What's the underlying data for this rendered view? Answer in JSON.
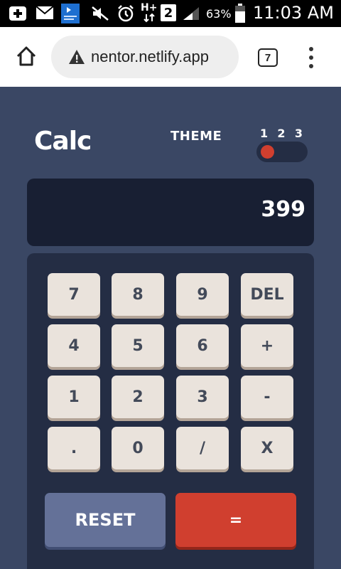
{
  "status_bar": {
    "battery": "63%",
    "time": "11:03 AM",
    "network_type": "H+",
    "sim_slot": "2",
    "icons": [
      "add-icon",
      "mail-icon",
      "app-icon",
      "mute-icon",
      "alarm-icon",
      "data-icon",
      "sim-icon",
      "signal-icon",
      "battery-icon"
    ]
  },
  "browser": {
    "url": "nentor.netlify.app",
    "tab_count": "7",
    "icons": [
      "home-icon",
      "warning-icon",
      "tabs-icon",
      "more-vert-icon"
    ]
  },
  "calculator": {
    "logo": "Calc",
    "theme_label": "THEME",
    "theme_options": [
      "1",
      "2",
      "3"
    ],
    "active_theme": "1",
    "display_value": "399",
    "keys": [
      "7",
      "8",
      "9",
      "DEL",
      "4",
      "5",
      "6",
      "+",
      "1",
      "2",
      "3",
      "-",
      ".",
      "0",
      "/",
      "X"
    ],
    "reset_label": "RESET",
    "equals_label": "="
  },
  "colors": {
    "background": "#3a4764",
    "keypad": "#242d44",
    "screen": "#181f33",
    "key": "#eae3dc",
    "key_text": "#434a59",
    "reset": "#647198",
    "equals": "#d03f2f"
  }
}
